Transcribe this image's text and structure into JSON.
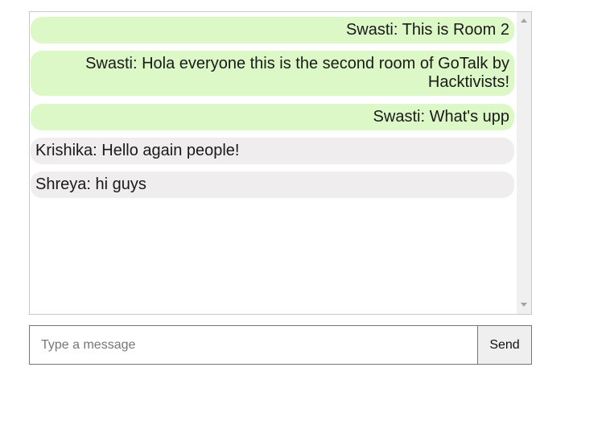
{
  "chat": {
    "messages": [
      {
        "sender": "Swasti",
        "text": "Swasti: This is Room 2",
        "own": true
      },
      {
        "sender": "Swasti",
        "text": "Swasti: Hola everyone this is the second room of GoTalk by Hacktivists!",
        "own": true
      },
      {
        "sender": "Swasti",
        "text": "Swasti: What's upp",
        "own": true
      },
      {
        "sender": "Krishika",
        "text": "Krishika: Hello again people!",
        "own": false
      },
      {
        "sender": "Shreya",
        "text": "Shreya: hi guys",
        "own": false
      }
    ]
  },
  "composer": {
    "placeholder": "Type a message",
    "value": "",
    "send_label": "Send"
  },
  "colors": {
    "own_bubble": "#dcf8c6",
    "other_bubble": "#efeded"
  }
}
